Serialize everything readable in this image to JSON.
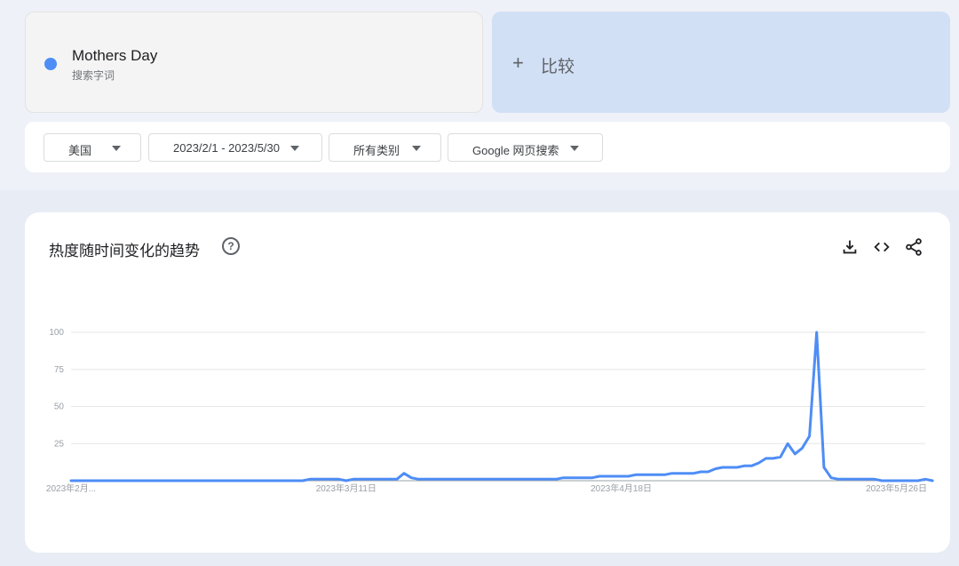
{
  "term": {
    "name": "Mothers Day",
    "type": "搜索字词",
    "color": "#4e8df5"
  },
  "compare": {
    "plus_icon": "plus-icon",
    "label": "比较"
  },
  "filters": {
    "region": "美国",
    "date_range": "2023/2/1 - 2023/5/30",
    "category": "所有类别",
    "property": "Google 网页搜索"
  },
  "panel": {
    "title": "热度随时间变化的趋势",
    "help_icon": "help-circle-icon",
    "tools": [
      "download-icon",
      "embed-code-icon",
      "share-icon"
    ]
  },
  "chart_data": {
    "type": "line",
    "title": "",
    "xlabel": "",
    "ylabel": "",
    "ylim": [
      0,
      100
    ],
    "yticks": [
      0,
      25,
      50,
      75,
      100
    ],
    "y_tick_labels": [
      "",
      "25",
      "50",
      "75",
      "100"
    ],
    "grid": true,
    "line_color": "#4e8df5",
    "x_tick_labels": [
      {
        "label": "2023年2月...",
        "index": 0
      },
      {
        "label": "2023年3月11日",
        "index": 38
      },
      {
        "label": "2023年4月18日",
        "index": 76
      },
      {
        "label": "2023年5月26日",
        "index": 114
      }
    ],
    "x_count": 119,
    "series": [
      {
        "values": [
          0,
          0,
          0,
          0,
          0,
          0,
          0,
          0,
          0,
          0,
          0,
          0,
          0,
          0,
          0,
          0,
          0,
          0,
          0,
          0,
          0,
          0,
          0,
          0,
          0,
          0,
          0,
          0,
          0,
          0,
          0,
          0,
          0,
          1,
          1,
          1,
          1,
          1,
          0,
          1,
          1,
          1,
          1,
          1,
          1,
          1,
          5,
          2,
          1,
          1,
          1,
          1,
          1,
          1,
          1,
          1,
          1,
          1,
          1,
          1,
          1,
          1,
          1,
          1,
          1,
          1,
          1,
          1,
          2,
          2,
          2,
          2,
          2,
          3,
          3,
          3,
          3,
          3,
          4,
          4,
          4,
          4,
          4,
          5,
          5,
          5,
          5,
          6,
          6,
          8,
          9,
          9,
          9,
          10,
          10,
          12,
          15,
          15,
          16,
          25,
          18,
          22,
          30,
          100,
          9,
          2,
          1,
          1,
          1,
          1,
          1,
          1,
          0,
          0,
          0,
          0,
          0,
          0,
          1,
          0
        ]
      }
    ]
  }
}
